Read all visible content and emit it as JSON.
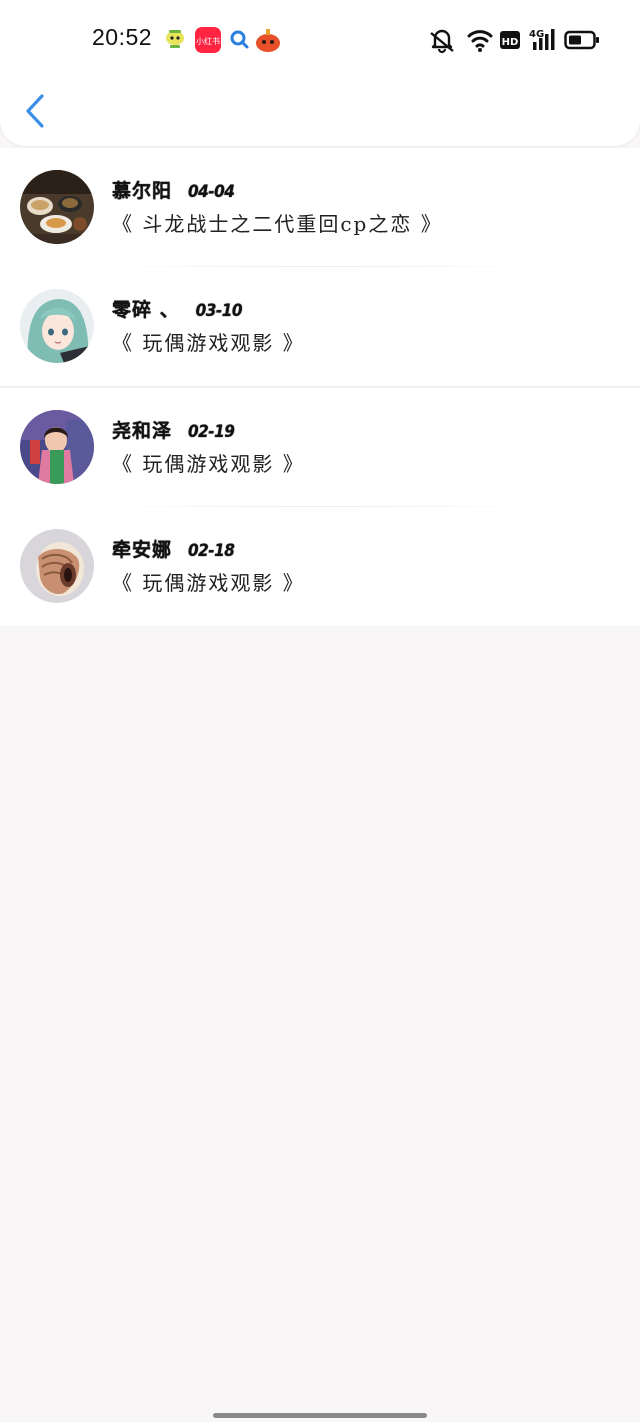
{
  "status_bar": {
    "time": "20:52",
    "network_label": "4G",
    "hd_label": "HD",
    "notification_icons": [
      "sprite-app-icon",
      "xiaohongshu-app-icon",
      "search-app-icon",
      "game-app-icon"
    ],
    "notification_badge_text": "小红书"
  },
  "header": {
    "back_icon": "chevron-left-icon",
    "accent": "#3b8fe8"
  },
  "entries": [
    {
      "name": "慕尔阳",
      "date": "04-04",
      "work": "《 斗龙战士之二代重回cp之恋 》",
      "avatar": "food-photo"
    },
    {
      "name": "零碎 、",
      "date": "03-10",
      "work": "《 玩偶游戏观影 》",
      "avatar": "anime-girl"
    },
    {
      "name": "尧和泽",
      "date": "02-19",
      "work": "《 玩偶游戏观影 》",
      "avatar": "girl-photo"
    },
    {
      "name": "牵安娜",
      "date": "02-18",
      "work": "《 玩偶游戏观影 》",
      "avatar": "nautilus-shell"
    }
  ]
}
